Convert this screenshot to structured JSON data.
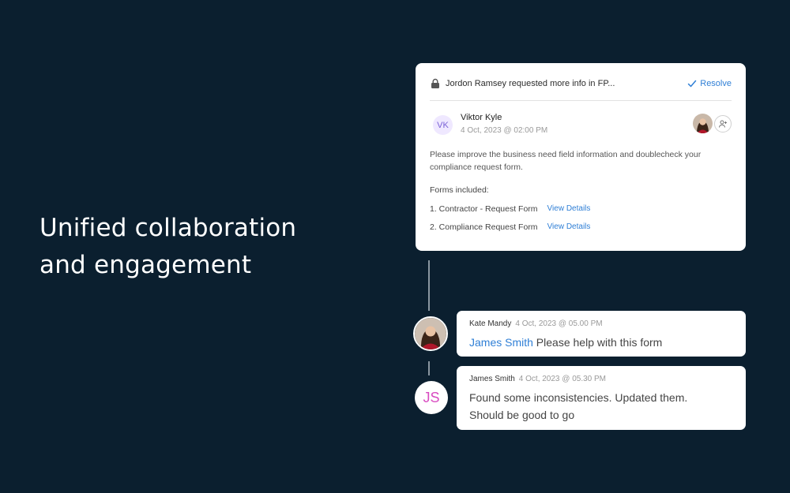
{
  "headline": {
    "line1": "Unified collaboration",
    "line2": "and engagement"
  },
  "card": {
    "title": "Jordon Ramsey requested more info in FP...",
    "resolve_label": "Resolve",
    "author": {
      "initials": "VK",
      "name": "Viktor Kyle",
      "time": "4 Oct, 2023 @ 02:00 PM"
    },
    "body": "Please improve the business need field information and doublecheck your compliance request form.",
    "forms_label": "Forms included:",
    "forms": [
      {
        "name": "1. Contractor - Request Form",
        "link": "View Details"
      },
      {
        "name": "2. Compliance Request Form",
        "link": "View Details"
      }
    ]
  },
  "comments": [
    {
      "author": "Kate Mandy",
      "time": "4 Oct, 2023 @ 05.00 PM",
      "mention": "James Smith",
      "text": " Please help with this form"
    },
    {
      "author": "James Smith",
      "initials": "JS",
      "time": "4 Oct, 2023 @ 05.30 PM",
      "line1": "Found some inconsistencies. Updated them.",
      "line2": "Should be good to go"
    }
  ],
  "colors": {
    "background": "#0b1f2f",
    "accent": "#2f7fd6",
    "js_initials": "#d94bc1",
    "vk_initials": "#7a62d6"
  },
  "icons": [
    "lock-icon",
    "checkmark-icon",
    "add-user-icon"
  ]
}
